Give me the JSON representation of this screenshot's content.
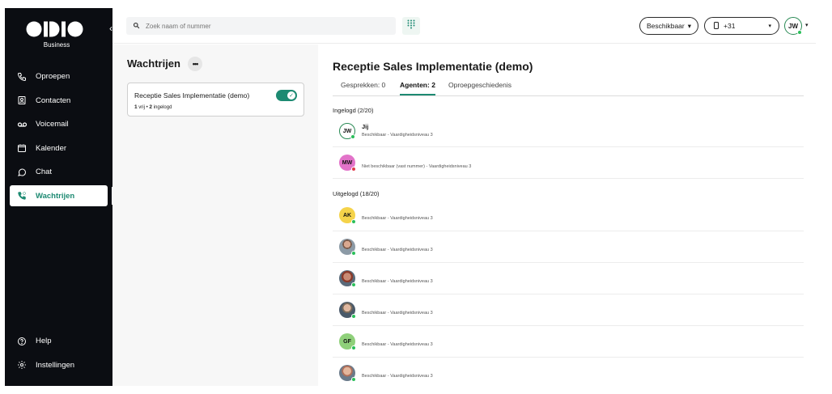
{
  "brand": {
    "subtitle": "Business"
  },
  "sidebar": {
    "items": [
      {
        "label": "Oproepen",
        "icon": "phone-icon"
      },
      {
        "label": "Contacten",
        "icon": "contact-card-icon"
      },
      {
        "label": "Voicemail",
        "icon": "voicemail-icon"
      },
      {
        "label": "Kalender",
        "icon": "calendar-icon"
      },
      {
        "label": "Chat",
        "icon": "chat-bubble-icon"
      },
      {
        "label": "Wachtrijen",
        "icon": "queue-phone-icon",
        "active": true
      }
    ],
    "bottom_items": [
      {
        "label": "Help",
        "icon": "help-icon"
      },
      {
        "label": "Instellingen",
        "icon": "gear-icon"
      }
    ]
  },
  "topbar": {
    "search_placeholder": "Zoek naam of nummer",
    "status_label": "Beschikbaar",
    "phone_label": "+31",
    "user_initials": "JW"
  },
  "queues_panel": {
    "title": "Wachtrijen",
    "queue": {
      "name": "Receptie Sales Implementatie (demo)",
      "free_count": "1",
      "free_label": "vrij",
      "loggedin_count": "2",
      "loggedin_label": "ingelogd",
      "enabled": true
    }
  },
  "main": {
    "title": "Receptie Sales Implementatie (demo)",
    "tabs": [
      {
        "label": "Gesprekken: 0"
      },
      {
        "label": "Agenten: 2",
        "active": true
      },
      {
        "label": "Oproepgeschiedenis"
      }
    ],
    "logged_in_label": "Ingelogd (2/20)",
    "logged_out_label": "Uitgelogd (18/20)",
    "logged_in": [
      {
        "initials": "JW",
        "name": "Jij",
        "status": "Beschikbaar - Vaardigheidsniveau 3",
        "presence": "online",
        "avatar_color": "#ffffff"
      },
      {
        "initials": "MW",
        "name": "",
        "status": "Niet beschikbaar (vast nummer) - Vaardigheidsniveau 3",
        "presence": "busy",
        "avatar_color": "#e273c9"
      }
    ],
    "logged_out": [
      {
        "initials": "AK",
        "status": "Beschikbaar - Vaardigheidsniveau 3",
        "avatar_color": "#f5d34a"
      },
      {
        "initials": "",
        "status": "Beschikbaar - Vaardigheidsniveau 3",
        "photo": true
      },
      {
        "initials": "",
        "status": "Beschikbaar - Vaardigheidsniveau 3",
        "photo": true
      },
      {
        "initials": "",
        "status": "Beschikbaar - Vaardigheidsniveau 3",
        "photo": true
      },
      {
        "initials": "GF",
        "status": "Beschikbaar - Vaardigheidsniveau 3",
        "avatar_color": "#8fd07a"
      },
      {
        "initials": "",
        "status": "Beschikbaar - Vaardigheidsniveau 3",
        "photo": true
      }
    ]
  },
  "colors": {
    "accent": "#1d8a72",
    "sidebar_bg": "#0b0d12",
    "online": "#2bbf5a",
    "busy": "#e03a4a"
  }
}
